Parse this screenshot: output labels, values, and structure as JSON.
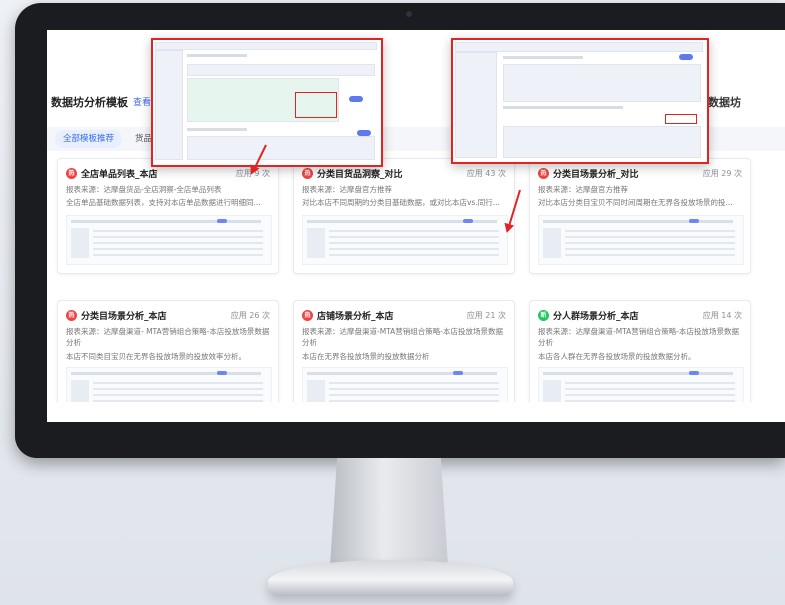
{
  "page": {
    "title": "数据坊分析模板",
    "title_link": "查看",
    "right_title": "· 数据坊"
  },
  "tabs": [
    {
      "label": "全部模板推荐",
      "active": true
    },
    {
      "label": "货品",
      "active": false
    }
  ],
  "cards": [
    {
      "badge_color": "#ef4444",
      "badge_icon": "fire-icon",
      "title": "全店单品列表_本店",
      "uses": "应用 9 次",
      "source": "报表来源：达摩盘货品-全店洞察-全店单品列表",
      "desc": "全店单品基础数据列表，支持对本店单品数据进行明细同..."
    },
    {
      "badge_color": "#ef4444",
      "badge_icon": "fire-icon",
      "title": "分类目货品洞察_对比",
      "uses": "应用 43 次",
      "source": "报表来源：达摩盘官方推荐",
      "desc": "对比本店不同周期的分类目基础数据，或对比本店vs.同行..."
    },
    {
      "badge_color": "#ef4444",
      "badge_icon": "fire-icon",
      "title": "分类目场景分析_对比",
      "uses": "应用 29 次",
      "source": "报表来源：达摩盘官方推荐",
      "desc": "对比本店分类目宝贝不同时间周期在无界各投放场景的投..."
    },
    {
      "badge_color": "#ef4444",
      "badge_icon": "fire-icon",
      "title": "分类目场景分析_本店",
      "uses": "应用 26 次",
      "source": "报表来源：达摩盘渠道- MTA营销组合策略-本店投放场景数据分析",
      "desc": "本店不同类目宝贝在无界各投放场景的投放效率分析。"
    },
    {
      "badge_color": "#ef4444",
      "badge_icon": "fire-icon",
      "title": "店铺场景分析_本店",
      "uses": "应用 21 次",
      "source": "报表来源：达摩盘渠道-MTA营销组合策略-本店投放场景数据分析",
      "desc": "本店在无界各投放场景的投放数据分析"
    },
    {
      "badge_color": "#22c55e",
      "badge_icon": "new-icon",
      "title": "分人群场景分析_本店",
      "uses": "应用 14 次",
      "source": "报表来源：达摩盘渠道-MTA营销组合策略-本店投放场景数据分析",
      "desc": "本店各人群在无界各投放场景的投放数据分析。"
    }
  ]
}
